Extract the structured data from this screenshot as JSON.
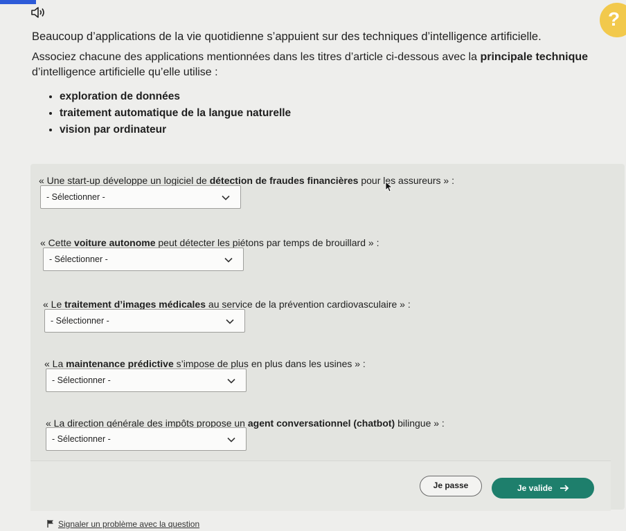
{
  "help": {
    "label": "?"
  },
  "intro": {
    "line1": "Beaucoup d’applications de la vie quotidienne s’appuient sur des techniques d’intelligence artificielle.",
    "line2_before": "Associez chacune des applications mentionnées dans les titres d’article ci-dessous avec la ",
    "line2_bold": "principale technique",
    "line2_after": "d’intelligence artificielle qu’elle utilise :"
  },
  "techniques": [
    "exploration de données",
    "traitement automatique de la langue naturelle",
    "vision par ordinateur"
  ],
  "questions": [
    {
      "before": "« Une start-up développe un logiciel de ",
      "bold": "détection de fraudes financières",
      "after": " pour les assureurs » :",
      "select": "- Sélectionner -"
    },
    {
      "before": "« Cette ",
      "bold": "voiture autonome",
      "after": " peut détecter les piétons par temps de brouillard » :",
      "select": "- Sélectionner -"
    },
    {
      "before": "« Le ",
      "bold": "traitement d’images médicales",
      "after": " au service de la prévention cardiovasculaire » :",
      "select": "- Sélectionner -"
    },
    {
      "before": "« La ",
      "bold": "maintenance prédictive",
      "after": " s’impose de plus en plus dans les usines » :",
      "select": "- Sélectionner -"
    },
    {
      "before": "« La direction générale des impôts propose un ",
      "bold": "agent conversationnel (chatbot)",
      "after": " bilingue » :",
      "select": "- Sélectionner -"
    }
  ],
  "actions": {
    "pass": "Je passe",
    "validate": "Je valide"
  },
  "footer": {
    "report": "Signaler un problème avec la question"
  },
  "colors": {
    "validate_bg": "#1e7f6c",
    "help_bg": "#f2c94c",
    "accent_bar": "#2d5bd8"
  }
}
